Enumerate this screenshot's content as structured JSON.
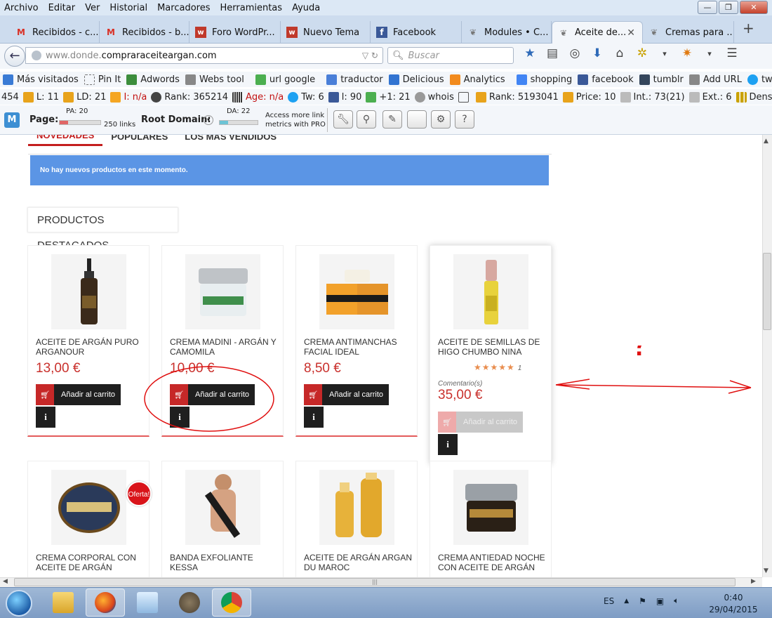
{
  "menu": [
    "Archivo",
    "Editar",
    "Ver",
    "Historial",
    "Marcadores",
    "Herramientas",
    "Ayuda"
  ],
  "tabs": [
    {
      "label": "Recibidos - c...",
      "icon": "gmail-icon",
      "color": "#d93025"
    },
    {
      "label": "Recibidos - b...",
      "icon": "gmail-icon",
      "color": "#d93025"
    },
    {
      "label": "Foro WordPr...",
      "icon": "webhost-icon",
      "color": "#c0392b"
    },
    {
      "label": "Nuevo Tema",
      "icon": "webhost-icon",
      "color": "#c0392b"
    },
    {
      "label": "Facebook",
      "icon": "facebook-icon",
      "color": "#3b5998"
    },
    {
      "label": "Modules • C...",
      "icon": "prestashop-icon",
      "color": "#777777"
    },
    {
      "label": "Aceite de...",
      "icon": "prestashop-icon",
      "color": "#777777"
    },
    {
      "label": "Cremas para ...",
      "icon": "prestashop-icon",
      "color": "#777777"
    }
  ],
  "url": {
    "prefix": "www.donde.",
    "domain": "compraraceiteargan.com"
  },
  "search_placeholder": "Buscar",
  "bookmarks": [
    {
      "label": "Más visitados",
      "color": "#3a7bd5"
    },
    {
      "label": "Pin It",
      "color": "#ffffff"
    },
    {
      "label": "Adwords",
      "color": "#3c8d3c"
    },
    {
      "label": "Webs tool",
      "color": "#888888"
    },
    {
      "label": "url google",
      "color": "#4caf50"
    },
    {
      "label": "traductor",
      "color": "#4a7fd8"
    },
    {
      "label": "Delicious",
      "color": "#3274d1"
    },
    {
      "label": "Analytics",
      "color": "#f28b1e"
    },
    {
      "label": "shopping",
      "color": "#4285f4"
    },
    {
      "label": "facebook",
      "color": "#3b5998"
    },
    {
      "label": "tumblr",
      "color": "#35465c"
    },
    {
      "label": "Add URL",
      "color": "#888888"
    },
    {
      "label": "twitter",
      "color": "#1da1f2"
    }
  ],
  "seo": [
    {
      "label": "454",
      "red": false
    },
    {
      "label": "L: 11",
      "red": false
    },
    {
      "label": "LD: 21",
      "red": false
    },
    {
      "label": "I: n/a",
      "red": true
    },
    {
      "label": "Rank: 365214",
      "red": false
    },
    {
      "label": "Age: n/a",
      "red": true
    },
    {
      "label": "Tw: 6",
      "red": false
    },
    {
      "label": "l: 90",
      "red": false
    },
    {
      "label": "+1: 21",
      "red": false
    },
    {
      "label": "whois",
      "red": false
    },
    {
      "label": "Rank: 5193041",
      "red": false
    },
    {
      "label": "Price: 10",
      "red": false
    },
    {
      "label": "Int.: 73(21)",
      "red": false
    },
    {
      "label": "Ext.: 6",
      "red": false
    },
    {
      "label": "Density",
      "red": false
    }
  ],
  "moz": {
    "page_label": "Page:",
    "pa": "PA: 20",
    "links": "250 links",
    "root_label": "Root Domain:",
    "da": "DA: 22",
    "pro_line1": "Access more link",
    "pro_line2": "metrics with PRO",
    "pa_fraction": 0.2,
    "da_fraction": 0.22
  },
  "content": {
    "tabs": [
      "NOVEDADES",
      "POPULARES",
      "LOS MÁS VENDIDOS"
    ],
    "no_new": "No hay nuevos productos en este momento.",
    "featured": "PRODUCTOS DESTACADOS",
    "cart_label": "Añadir al carrito",
    "info_label": "i",
    "products": [
      {
        "name": "ACEITE DE ARGÁN PURO ARGANOUR",
        "price": "13,00 €"
      },
      {
        "name": "CREMA MADINI - ARGÁN Y CAMOMILA",
        "price": "10,00 €"
      },
      {
        "name": "CREMA ANTIMANCHAS FACIAL IDEAL",
        "price": "8,50 €"
      },
      {
        "name": "ACEITE DE SEMILLAS DE HIGO CHUMBO NINA",
        "price": "35,00 €",
        "rating": 5,
        "rating_count": "1",
        "comment": "Comentario(s)"
      },
      {
        "name": "CREMA CORPORAL CON ACEITE DE ARGÁN",
        "badge": "Oferta!"
      },
      {
        "name": "BANDA EXFOLIANTE KESSA"
      },
      {
        "name": "ACEITE DE ARGÁN ARGAN DU MAROC"
      },
      {
        "name": "CREMA ANTIEDAD NOCHE CON ACEITE DE ARGÁN"
      }
    ],
    "annotation_mark": "?"
  },
  "taskbar": {
    "lang": "ES",
    "time": "0:40",
    "date": "29/04/2015"
  }
}
